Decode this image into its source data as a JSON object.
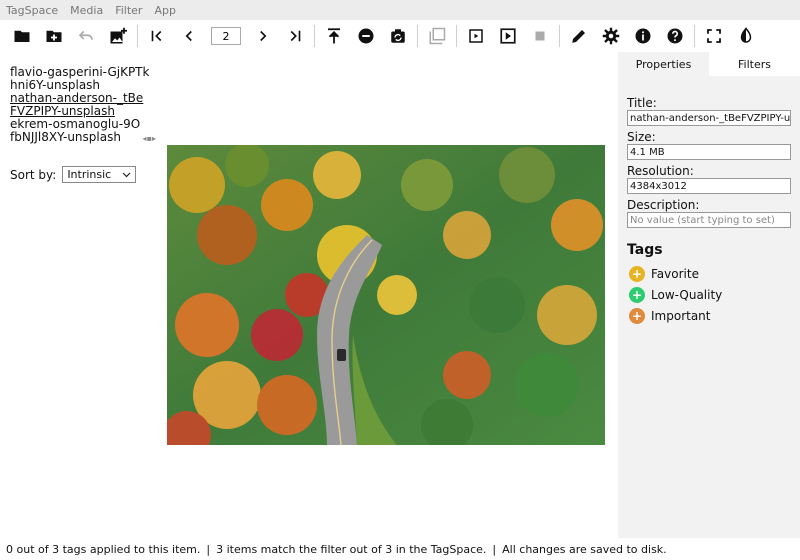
{
  "menu": [
    "TagSpace",
    "Media",
    "Filter",
    "App"
  ],
  "toolbar": {
    "page_number": "2",
    "icons": [
      "folder-icon",
      "new-folder-icon",
      "undo-icon",
      "add-image-icon",
      "first-icon",
      "prev-icon",
      "next-icon",
      "last-icon",
      "upload-icon",
      "remove-icon",
      "rotate-icon",
      "layers-icon",
      "play-frame-icon",
      "play-icon",
      "stop-icon",
      "edit-icon",
      "settings-icon",
      "info-icon",
      "help-icon",
      "fullscreen-icon",
      "contrast-icon"
    ]
  },
  "files": [
    {
      "name": "flavio-gasperini-GjKPTkhni6Y-unsplash",
      "selected": false
    },
    {
      "name": "nathan-anderson-_tBeFVZPIPY-unsplash",
      "selected": true
    },
    {
      "name": "ekrem-osmanoglu-9OfbNJJl8XY-unsplash",
      "selected": false
    }
  ],
  "sort": {
    "label": "Sort by:",
    "value": "Intrinsic"
  },
  "right_panel": {
    "tabs": [
      "Properties",
      "Filters"
    ],
    "title_label": "Title:",
    "title_value": "nathan-anderson-_tBeFVZPIPY-unsplash",
    "size_label": "Size:",
    "size_value": "4.1 MB",
    "resolution_label": "Resolution:",
    "resolution_value": "4384x3012",
    "description_label": "Description:",
    "description_placeholder": "No value (start typing to set)",
    "tags_heading": "Tags",
    "tags": [
      {
        "name": "Favorite",
        "color": "#e6b422"
      },
      {
        "name": "Low-Quality",
        "color": "#2ecc71"
      },
      {
        "name": "Important",
        "color": "#e08a3c"
      }
    ]
  },
  "status": {
    "tags_applied": "0 out of 3 tags applied to this item.",
    "filter_match": "3 items match the filter out of 3 in the TagSpace.",
    "saved": "All changes are saved to disk."
  }
}
